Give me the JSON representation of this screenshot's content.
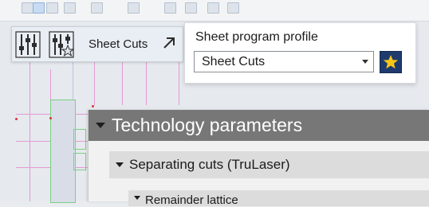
{
  "sheet_cuts_panel": {
    "label": "Sheet Cuts",
    "icons": [
      "sliders-icon",
      "sliders-star-icon",
      "open-arrow-icon"
    ]
  },
  "profile_panel": {
    "title": "Sheet program profile",
    "selected_value": "Sheet Cuts",
    "icons": [
      "chevron-down-icon",
      "favorite-star-icon"
    ]
  },
  "tech_params": {
    "header": "Technology parameters",
    "section": "Separating cuts (TruLaser)",
    "subsection": "Remainder lattice"
  },
  "colors": {
    "header_bg": "#777777",
    "section_bg": "#dcdcdc",
    "favorite_bg": "#1f3a6e",
    "star": "#f5c518",
    "grid_line": "#e39ad3",
    "part_outline": "#7ccf86"
  }
}
